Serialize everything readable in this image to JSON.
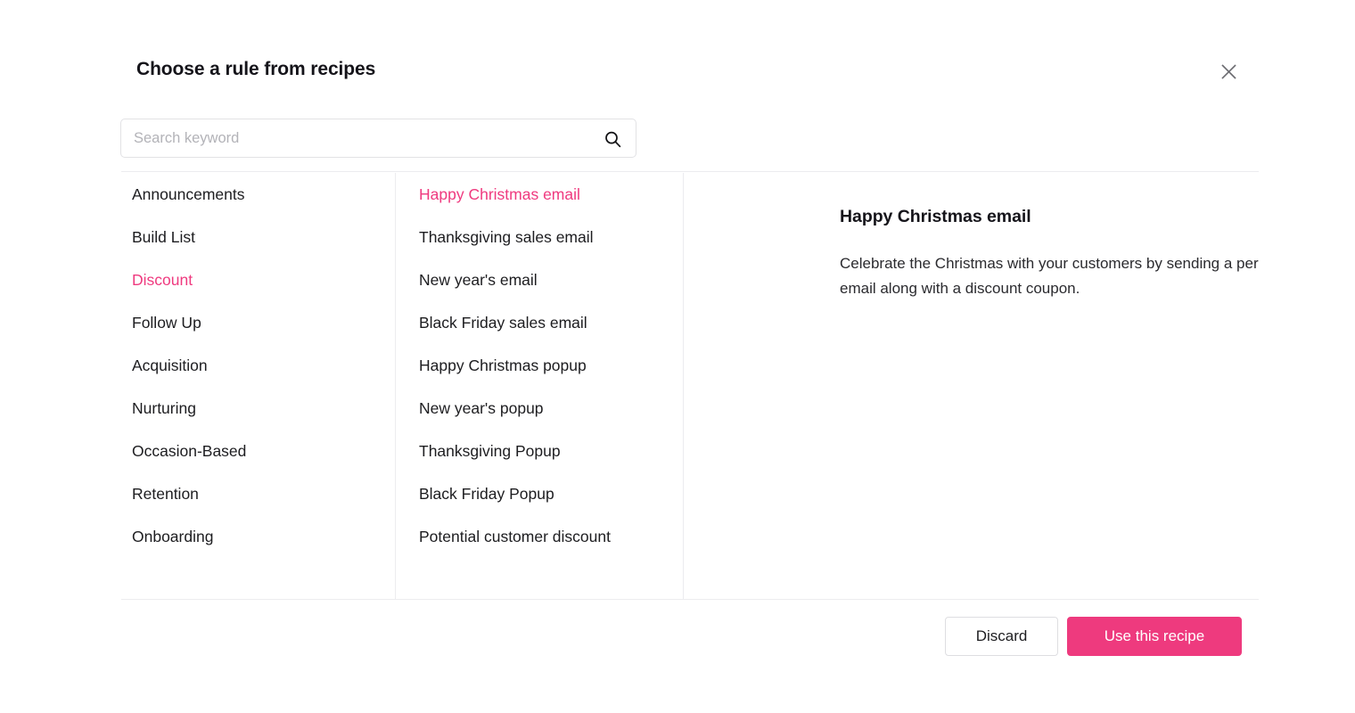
{
  "dialog": {
    "title": "Choose a rule from recipes",
    "close_icon": "close-icon"
  },
  "search": {
    "placeholder": "Search keyword",
    "value": "",
    "icon": "search-icon"
  },
  "categories": {
    "selected": "Discount",
    "items": [
      {
        "label": "Announcements",
        "selected": false
      },
      {
        "label": "Build List",
        "selected": false
      },
      {
        "label": "Discount",
        "selected": true
      },
      {
        "label": "Follow Up",
        "selected": false
      },
      {
        "label": "Acquisition",
        "selected": false
      },
      {
        "label": "Nurturing",
        "selected": false
      },
      {
        "label": "Occasion-Based",
        "selected": false
      },
      {
        "label": "Retention",
        "selected": false
      },
      {
        "label": "Onboarding",
        "selected": false
      }
    ]
  },
  "recipes": {
    "selected": "Happy Christmas email",
    "items": [
      {
        "label": "Happy Christmas email",
        "selected": true
      },
      {
        "label": "Thanksgiving sales email",
        "selected": false
      },
      {
        "label": "New year's email",
        "selected": false
      },
      {
        "label": "Black Friday sales email",
        "selected": false
      },
      {
        "label": "Happy Christmas popup",
        "selected": false
      },
      {
        "label": "New year's popup",
        "selected": false
      },
      {
        "label": "Thanksgiving Popup",
        "selected": false
      },
      {
        "label": "Black Friday Popup",
        "selected": false
      },
      {
        "label": "Potential customer discount",
        "selected": false
      }
    ]
  },
  "detail": {
    "title": "Happy Christmas email",
    "description": "Celebrate the Christmas with your customers by sending a personalized email along with a discount coupon."
  },
  "footer": {
    "discard_label": "Discard",
    "primary_label": "Use this recipe"
  },
  "colors": {
    "accent": "#ee3a7e",
    "accent_text": "#ef3a7f",
    "border": "#ececef",
    "input_border": "#e2e2e5",
    "placeholder": "#b3b3b8",
    "text": "#1d1d20",
    "background": "#ffffff"
  }
}
